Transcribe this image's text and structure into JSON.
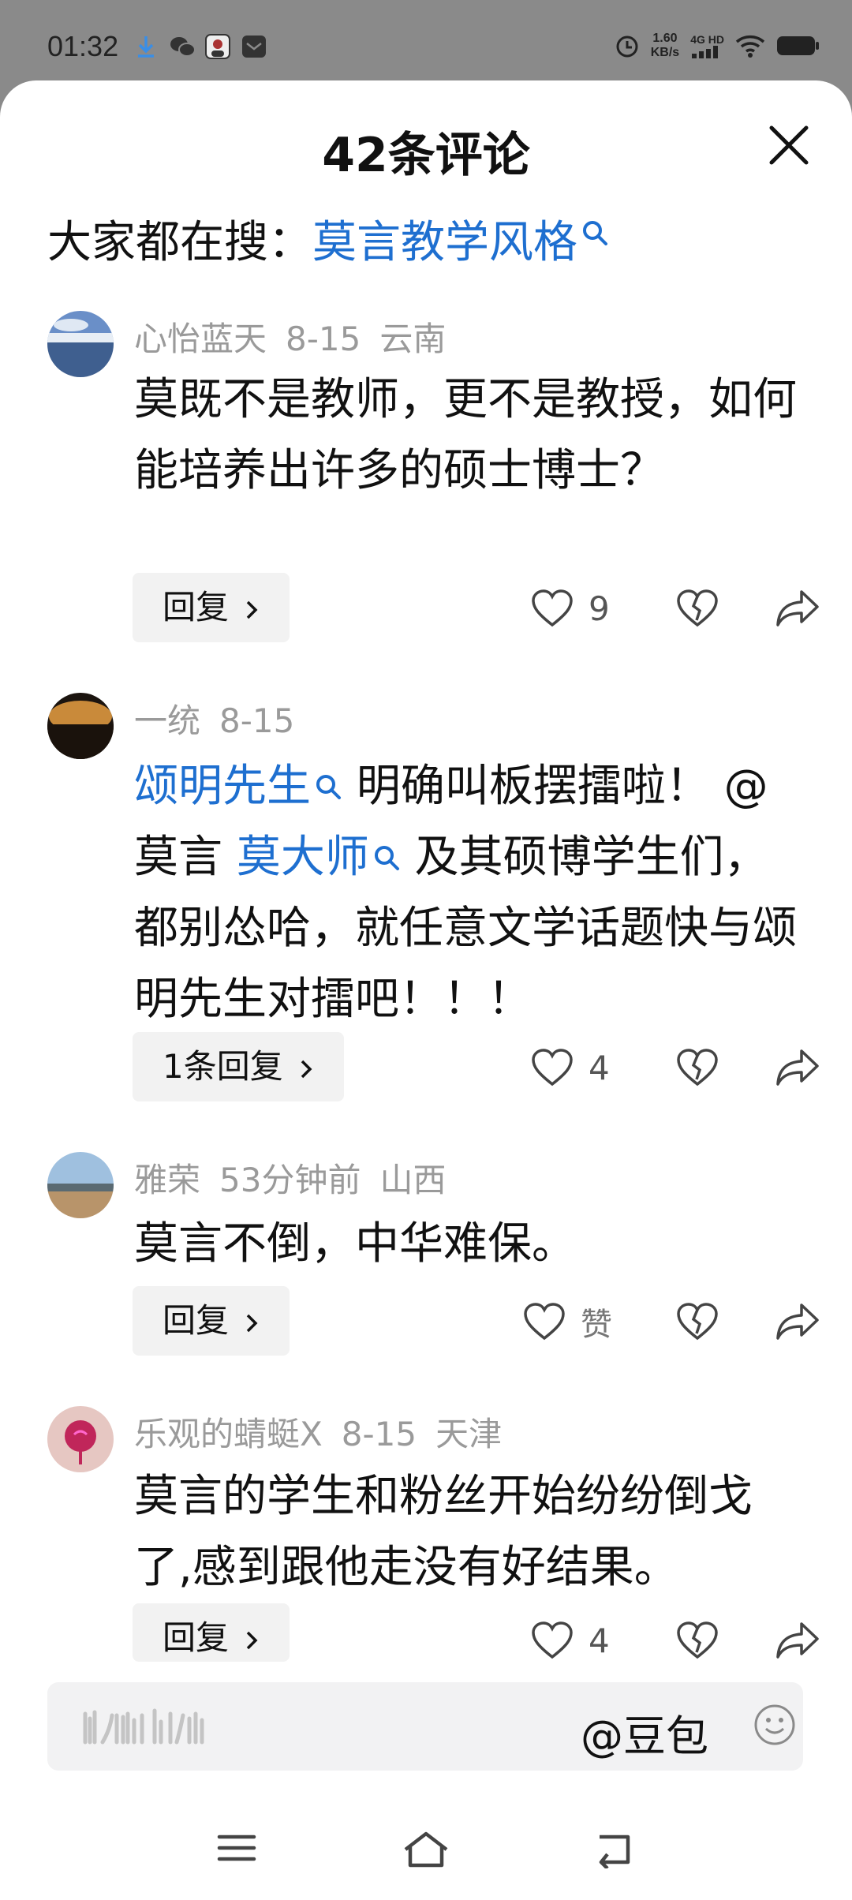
{
  "status_bar": {
    "time": "01:32",
    "net_speed_value": "1.60",
    "net_speed_unit": "KB/s",
    "network": "4G HD",
    "icons": [
      "download-icon",
      "wechat-icon",
      "user-photo-icon",
      "mail-icon",
      "alarm-icon",
      "signal-icon",
      "wifi-icon",
      "battery-icon"
    ]
  },
  "header": {
    "title": "42条评论",
    "close_icon": "close-icon"
  },
  "trending": {
    "label": "大家都在搜：",
    "term": "莫言教学风格"
  },
  "comments": [
    {
      "user": "心怡蓝天",
      "date": "8-15",
      "location": "云南",
      "text": "莫既不是教师，更不是教授，如何能培养出许多的硕士博士？",
      "reply_label": "回复",
      "likes": "9"
    },
    {
      "user": "一统",
      "date": "8-15",
      "link1": "颂明先生",
      "text_a": "明确叫板摆擂啦！",
      "text_b": "@莫言",
      "link2": "莫大师",
      "text_c": "及其硕博学生们，都别怂哈，就任意文学话题快与颂明先生对擂吧！！！",
      "reply_label": "1条回复",
      "likes": "4"
    },
    {
      "user": "雅荣",
      "date": "53分钟前",
      "location": "山西",
      "text": "莫言不倒，中华难保。",
      "reply_label": "回复",
      "likes": "赞"
    },
    {
      "user": "乐观的蜻蜓X",
      "date": "8-15",
      "location": "天津",
      "text": "莫言的学生和粉丝开始纷纷倒戈了,感到跟他走没有好结果。",
      "reply_label": "回复",
      "likes": "4"
    }
  ],
  "input_bar": {
    "mention": "@豆包",
    "emoji_icon": "emoji-icon"
  },
  "nav_bar": {
    "icons": [
      "menu-icon",
      "home-icon",
      "back-icon"
    ]
  },
  "colors": {
    "link": "#1e6fd0",
    "meta": "#9a9a9a",
    "button_bg": "#f2f2f2"
  }
}
